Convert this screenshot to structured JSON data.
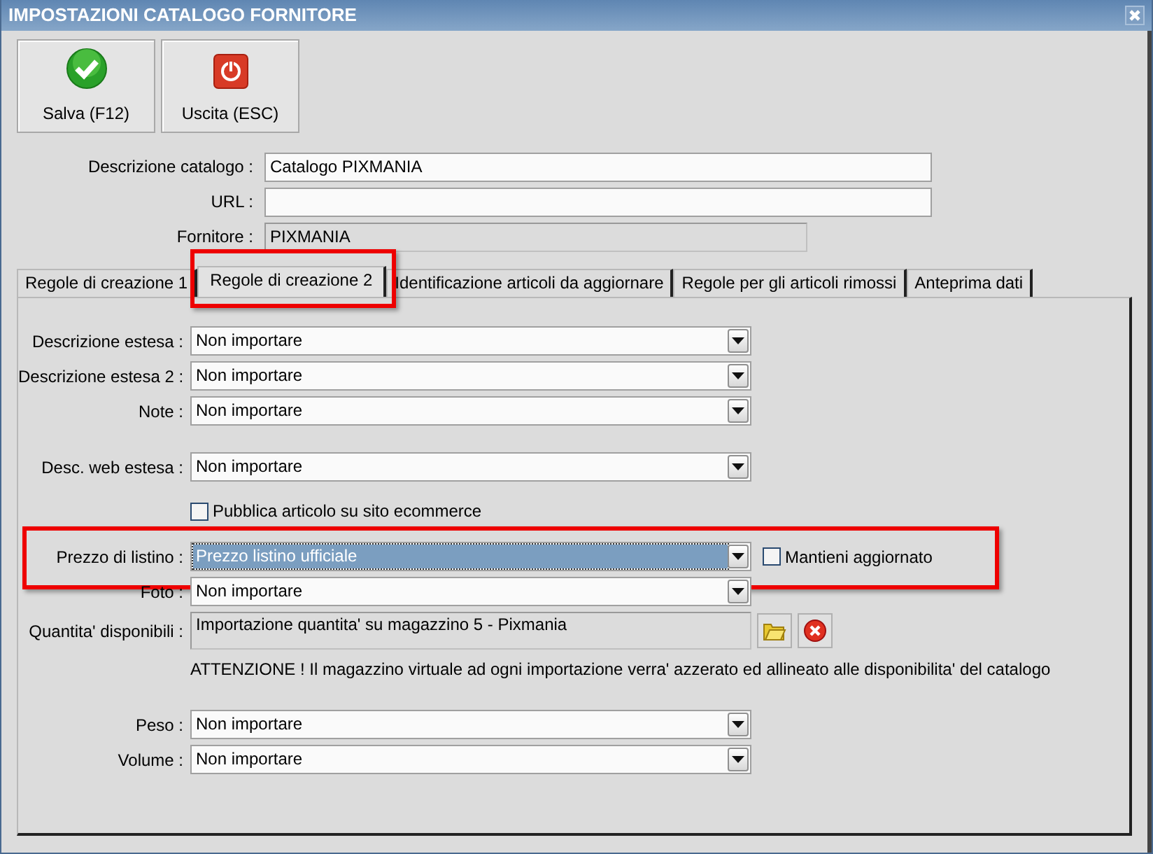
{
  "window": {
    "title": "IMPOSTAZIONI CATALOGO FORNITORE"
  },
  "toolbar": [
    {
      "kind": "save",
      "label": "Salva (F12)"
    },
    {
      "kind": "exit",
      "label": "Uscita (ESC)"
    }
  ],
  "header_fields": [
    {
      "label": "Descrizione catalogo :",
      "value": "Catalogo PIXMANIA",
      "disabled": false,
      "wide": true
    },
    {
      "label": "URL :",
      "disabled": false,
      "wide": true
    },
    {
      "label": "Fornitore :",
      "value": "PIXMANIA",
      "disabled": true,
      "wide": false
    }
  ],
  "tabs": [
    {
      "label": "Regole di creazione 1",
      "selected": false,
      "marked": false
    },
    {
      "label": "Regole di creazione 2",
      "selected": true,
      "marked": true
    },
    {
      "label": "Identificazione articoli da aggiornare",
      "selected": false,
      "marked": false
    },
    {
      "label": "Regole per gli articoli rimossi",
      "selected": false,
      "marked": false
    },
    {
      "label": "Anteprima dati",
      "selected": false,
      "marked": false
    }
  ],
  "rows": [
    {
      "kind": "combo",
      "label": "Descrizione estesa :",
      "value": "Non importare",
      "selected": false,
      "gap_before": false,
      "marked": false
    },
    {
      "kind": "combo",
      "label": "Descrizione estesa 2 :",
      "value": "Non importare",
      "selected": false,
      "gap_before": false,
      "marked": false
    },
    {
      "kind": "combo",
      "label": "Note :",
      "value": "Non importare",
      "selected": false,
      "gap_before": false,
      "marked": false
    },
    {
      "kind": "combo",
      "label": "Desc. web estesa :",
      "value": "Non importare",
      "selected": false,
      "gap_before": true,
      "marked": false
    },
    {
      "kind": "checkbox",
      "label": "Pubblica articolo su sito ecommerce",
      "checked": false
    },
    {
      "kind": "combo",
      "label": "Prezzo di listino :",
      "value": "Prezzo listino ufficiale",
      "selected": true,
      "gap_before": false,
      "marked": true,
      "side_checkbox": {
        "label": "Mantieni aggiornato",
        "checked": false
      }
    },
    {
      "kind": "combo",
      "label": "Foto :",
      "value": "Non importare",
      "selected": false,
      "gap_before": false,
      "marked": false
    },
    {
      "kind": "picker",
      "label": "Quantita' disponibili :",
      "value": "Importazione quantita' su magazzino 5 - Pixmania",
      "gap_before": false
    },
    {
      "kind": "note",
      "text": "ATTENZIONE ! Il magazzino virtuale ad ogni importazione verra' azzerato ed allineato alle disponibilita' del catalogo",
      "gap_before": false
    },
    {
      "kind": "combo",
      "label": "Peso :",
      "value": "Non importare",
      "selected": false,
      "gap_before": true,
      "marked": false
    },
    {
      "kind": "combo",
      "label": "Volume :",
      "value": "Non importare",
      "selected": false,
      "gap_before": false,
      "marked": false
    }
  ]
}
